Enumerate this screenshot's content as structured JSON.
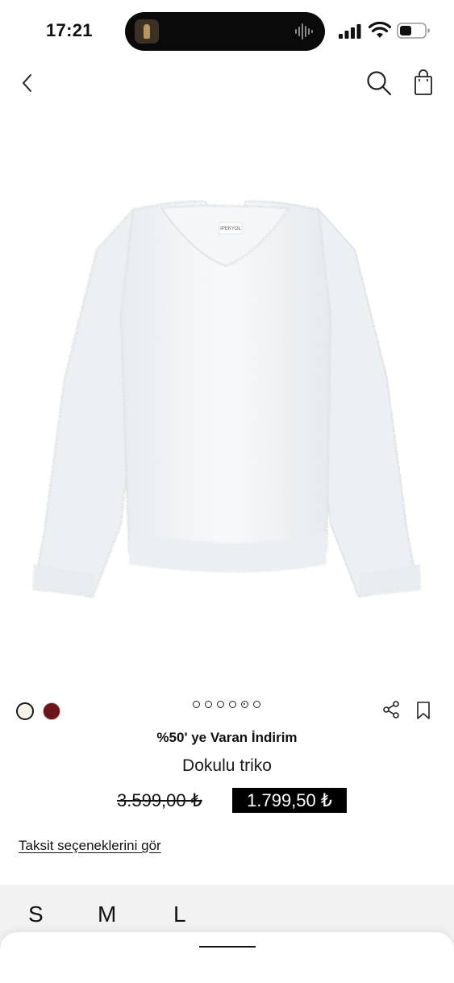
{
  "status_bar": {
    "time": "17:21"
  },
  "nav": {
    "back_icon": "chevron-left-icon",
    "search_icon": "search-icon",
    "bag_icon": "shopping-bag-icon"
  },
  "product": {
    "image_brand_label": "IPEKYOL",
    "colors": [
      {
        "name": "white",
        "hex": "#f7f3ea",
        "selected": true
      },
      {
        "name": "burgundy",
        "hex": "#6b1518",
        "selected": false
      }
    ],
    "image_count": 6,
    "active_image_index": 4,
    "promo": "%50' ye Varan İndirim",
    "name": "Dokulu triko",
    "old_price": "3.599,00 ₺",
    "new_price": "1.799,50 ₺",
    "installment_link": "Taksit seçeneklerini gör"
  },
  "sizes": [
    "S",
    "M",
    "L"
  ],
  "colors": {
    "price_badge_bg": "#000000",
    "size_panel_bg": "#f2f2f2"
  }
}
